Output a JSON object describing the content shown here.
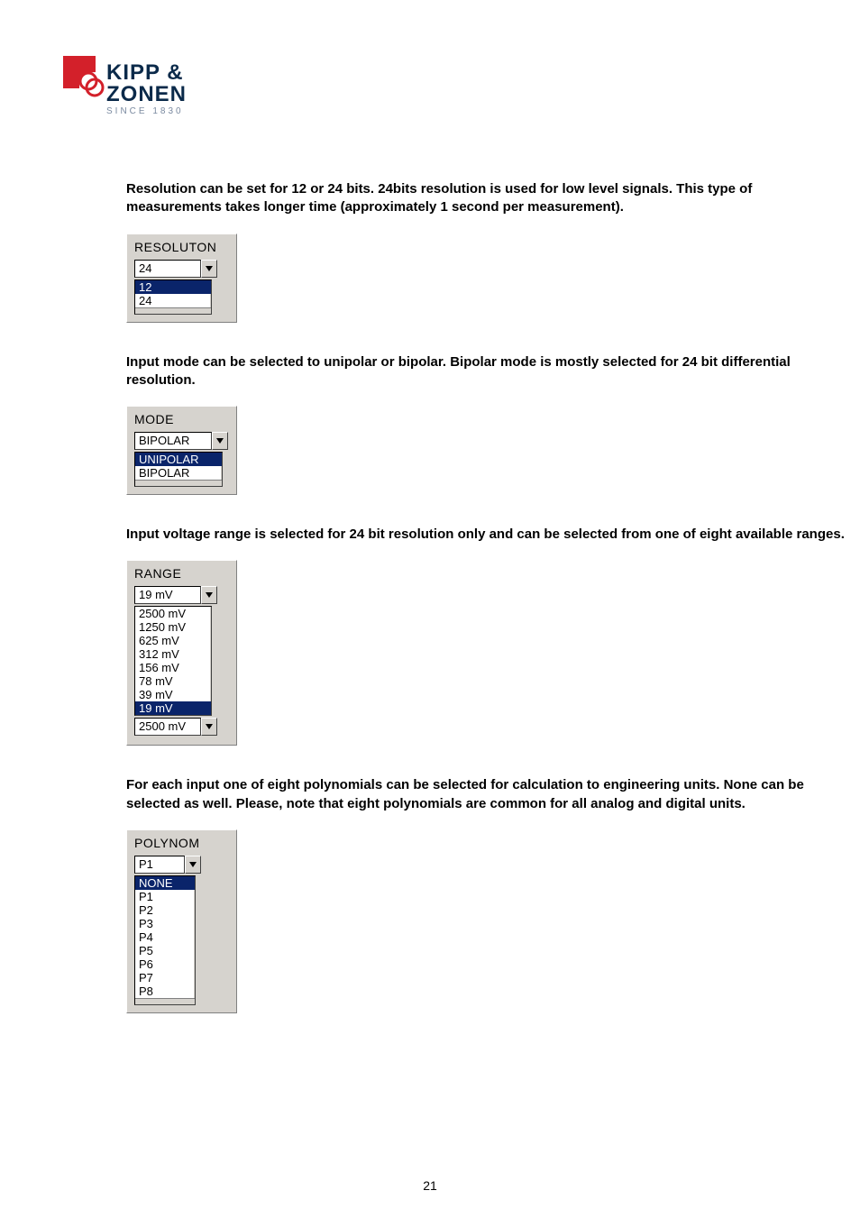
{
  "logo": {
    "name": "KIPP & ZONEN",
    "tagline": "SINCE 1830"
  },
  "page_number": "21",
  "resolution": {
    "description": "Resolution can be set for 12 or 24 bits. 24bits resolution is used for low level signals. This type of measurements takes longer time (approximately 1 second per measurement).",
    "panel_title": "RESOLUTON",
    "selected": "24",
    "options": [
      "12",
      "24"
    ],
    "highlighted": "12"
  },
  "mode": {
    "description": "Input mode can be selected to unipolar or bipolar. Bipolar mode is mostly selected for 24 bit differential resolution.",
    "panel_title": "MODE",
    "selected": "BIPOLAR",
    "options": [
      "UNIPOLAR",
      "BIPOLAR"
    ],
    "highlighted": "UNIPOLAR"
  },
  "range": {
    "description": "Input voltage range is selected for 24 bit resolution only and can be selected from one of eight available ranges.",
    "panel_title": "RANGE",
    "selected": "19 mV",
    "options": [
      "2500 mV",
      "1250 mV",
      "625 mV",
      "312 mV",
      "156 mV",
      "78 mV",
      "39 mV",
      "19 mV"
    ],
    "highlighted": "19 mV",
    "secondary_selected": "2500 mV"
  },
  "polynom": {
    "description": "For each input one of eight polynomials can be selected for calculation to engineering units. None can be selected as well. Please, note that eight polynomials are common for all analog and digital units.",
    "panel_title": "POLYNOM",
    "selected": "P1",
    "options": [
      "NONE",
      "P1",
      "P2",
      "P3",
      "P4",
      "P5",
      "P6",
      "P7",
      "P8"
    ],
    "highlighted": "NONE"
  }
}
